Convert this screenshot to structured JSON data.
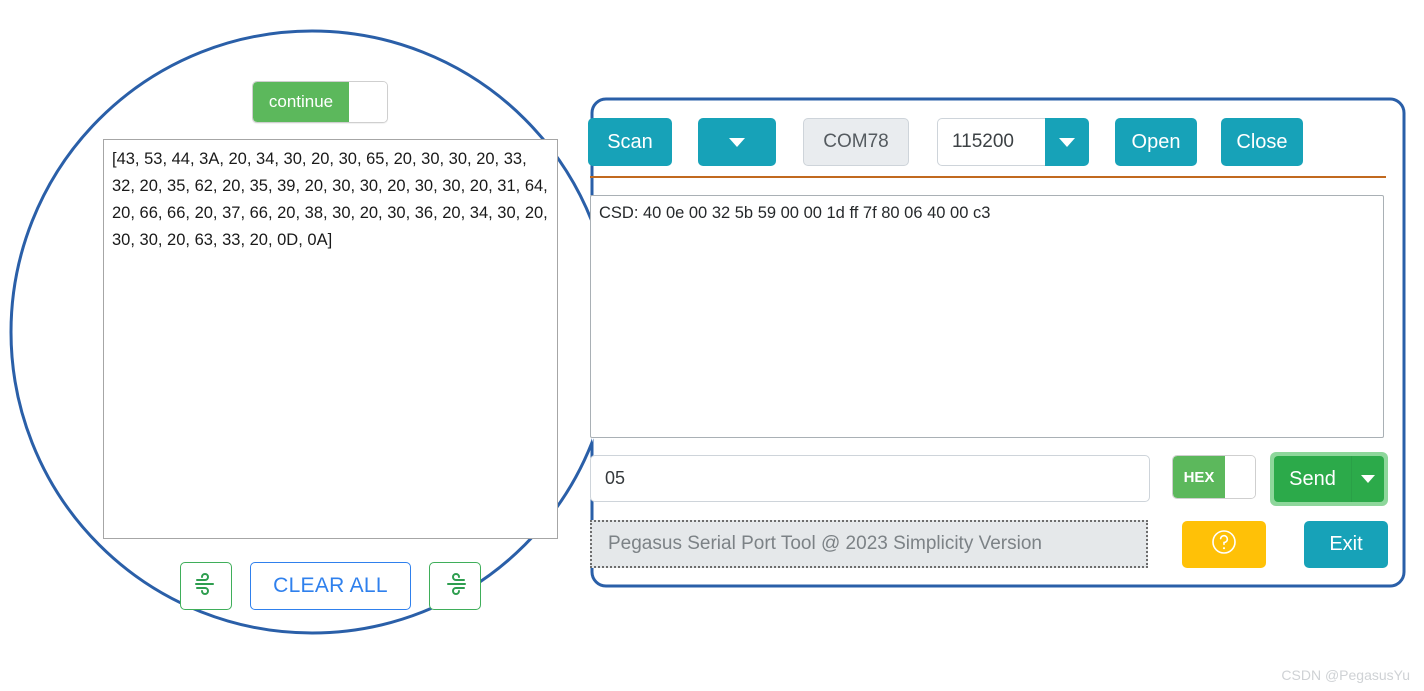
{
  "callout": {
    "outline_color": "#2a5fa8"
  },
  "left_bubble": {
    "continue_toggle": {
      "label": "continue",
      "state": "on",
      "on_color": "#5cb85c"
    },
    "hex_dump": {
      "text": "[43, 53, 44, 3A, 20, 34, 30, 20, 30, 65, 20, 30, 30, 20, 33, 32, 20, 35, 62, 20, 35, 39, 20, 30, 30, 20, 30, 30, 20, 31, 64, 20, 66, 66, 20, 37, 66, 20, 38, 30, 20, 30, 36, 20, 34, 30, 20, 30, 30, 20, 63, 33, 20, 0D, 0A]"
    },
    "buttons": {
      "flow_left": "wind-left-icon",
      "clear_all": "CLEAR ALL",
      "flow_right": "wind-right-icon"
    }
  },
  "serial_tool": {
    "toolbar": {
      "scan_label": "Scan",
      "port_dropdown_icon": "chevron-down-icon",
      "port_value": "COM78",
      "baud_value": "115200",
      "baud_dropdown_icon": "chevron-down-icon",
      "open_label": "Open",
      "close_label": "Close"
    },
    "receive": {
      "text": "CSD: 40 0e 00 32 5b 59 00 00 1d ff 7f 80 06 40 00 c3"
    },
    "send": {
      "input_value": "05",
      "input_placeholder": "",
      "hex_label": "HEX",
      "hex_state": "on",
      "send_label": "Send",
      "send_dropdown_icon": "chevron-down-icon"
    },
    "status": {
      "text": "Pegasus Serial Port Tool @ 2023 Simplicity Version",
      "help_icon": "question-circle-icon",
      "exit_label": "Exit"
    },
    "colors": {
      "teal": "#17a2b8",
      "green": "#2caa4a",
      "yellow": "#ffc107",
      "divider": "#c1691f"
    }
  },
  "watermark": {
    "text": "CSDN @PegasusYu"
  }
}
